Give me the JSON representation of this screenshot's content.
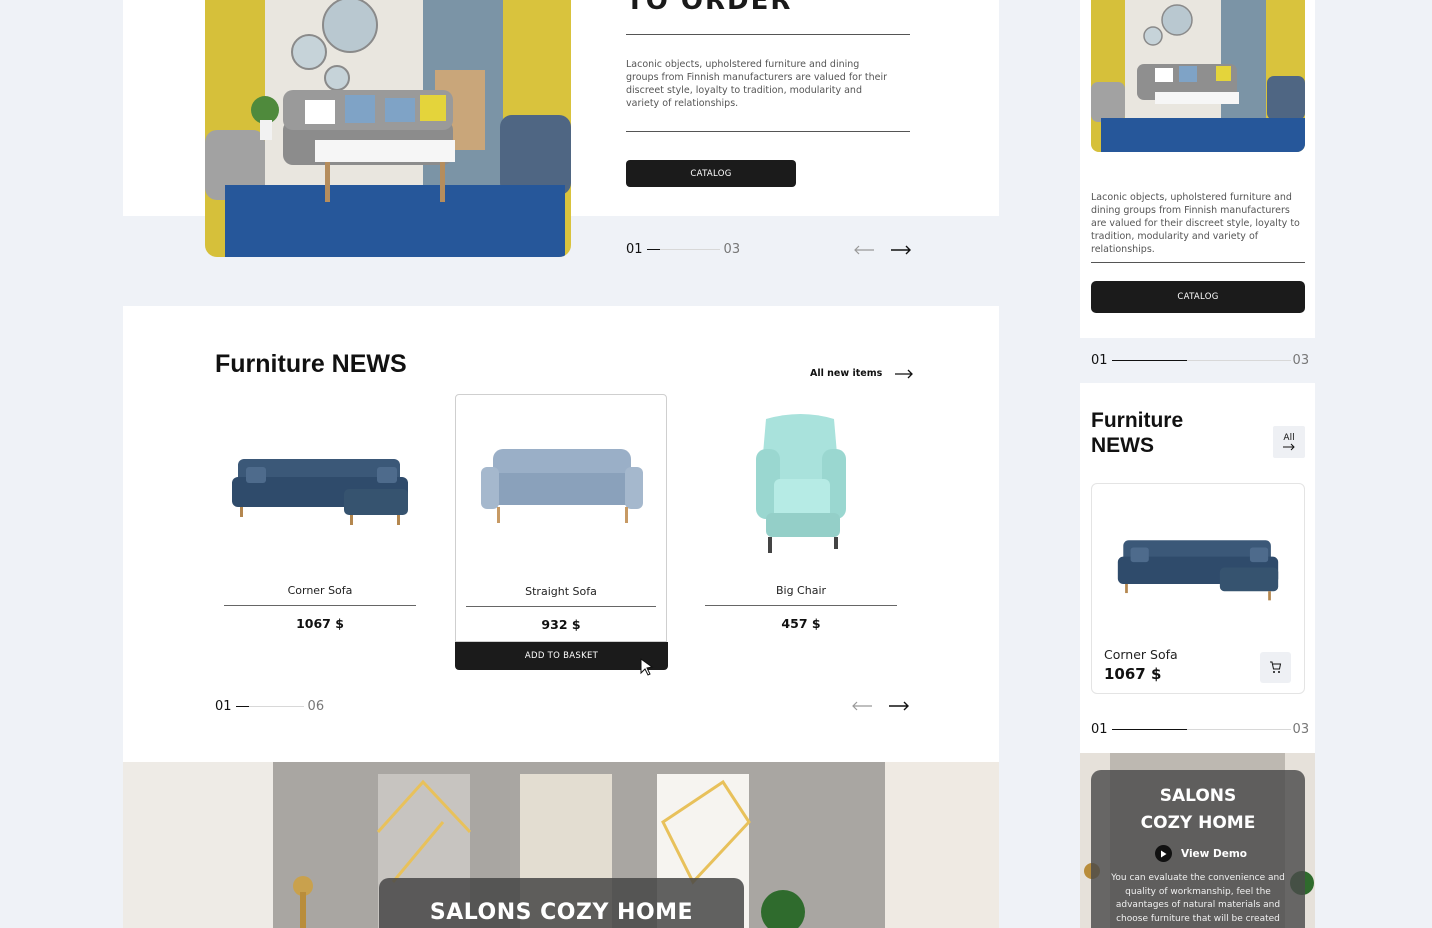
{
  "colors": {
    "background": "#eff2f7",
    "card": "#ffffff",
    "dark_button": "#1b1b1b",
    "accent_blue": "#3d5a7a"
  },
  "hero": {
    "title_fragment": "TO ORDER",
    "description": "Laconic objects, upholstered furniture and dining groups from Finnish manufacturers are valued for their discreet style, loyalty to tradition, modularity and variety of relationships.",
    "catalog_label": "CATALOG",
    "pager": {
      "current": "01",
      "total": "03"
    }
  },
  "news": {
    "title_light": "Furniture",
    "title_bold": "NEWS",
    "all_items_label": "All new items",
    "products": [
      {
        "name": "Corner Sofa",
        "price": "1067 $",
        "icon": "corner-sofa-image"
      },
      {
        "name": "Straight Sofa",
        "price": "932 $",
        "icon": "straight-sofa-image"
      },
      {
        "name": "Big Chair",
        "price": "457 $",
        "icon": "armchair-image"
      }
    ],
    "add_to_basket_label": "ADD TO BASKET",
    "pager": {
      "current": "01",
      "total": "06"
    }
  },
  "salons": {
    "title": "SALONS COZY HOME"
  },
  "mobile": {
    "description": "Laconic objects, upholstered furniture and dining groups from Finnish manufacturers are valued for their discreet style, loyalty to tradition, modularity and variety of relationships.",
    "catalog_label": "CATALOG",
    "pager1": {
      "current": "01",
      "total": "03"
    },
    "news_title_light": "Furniture",
    "news_title_bold": "NEWS",
    "all_label": "All",
    "product": {
      "name": "Corner Sofa",
      "price": "1067 $"
    },
    "pager2": {
      "current": "01",
      "total": "03"
    },
    "salons_title_line1": "SALONS",
    "salons_title_line2": "COZY HOME",
    "view_demo_label": "View Demo",
    "salons_description": "You can evaluate the convenience and quality of workmanship, feel the advantages of natural materials and choose furniture that will be created"
  }
}
